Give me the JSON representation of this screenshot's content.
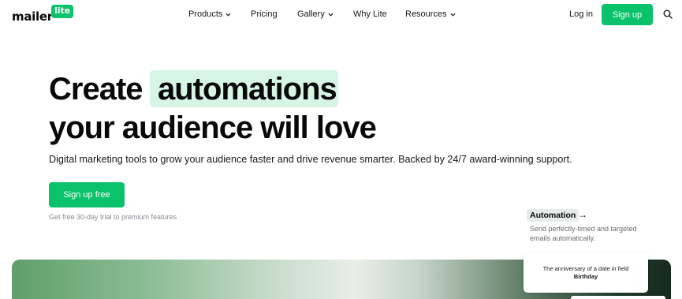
{
  "logo": {
    "main": "mailer",
    "badge": "lite"
  },
  "nav": {
    "items": [
      {
        "label": "Products",
        "dropdown": true
      },
      {
        "label": "Pricing",
        "dropdown": false
      },
      {
        "label": "Gallery",
        "dropdown": true
      },
      {
        "label": "Why Lite",
        "dropdown": false
      },
      {
        "label": "Resources",
        "dropdown": true
      }
    ],
    "login": "Log in",
    "signup": "Sign up",
    "search_icon": "search-icon"
  },
  "hero": {
    "line1_a": "Create",
    "line1_b": "automations",
    "line2": "your audience will love",
    "subtitle": "Digital marketing tools to grow your audience faster and drive revenue smarter. Backed by 24/7 award-winning support.",
    "cta": "Sign up free",
    "trial_note": "Get free 30-day trial to premium features"
  },
  "automation": {
    "title": "Automation",
    "arrow": "→",
    "description": "Send perfectly-timed and targeted emails automatically."
  },
  "popup": {
    "text": "The anniversary of a date in field",
    "field": "Birthday"
  },
  "colors": {
    "brand_green": "#09c269",
    "highlight": "#d7f5e4",
    "text_dark": "#09090b"
  }
}
